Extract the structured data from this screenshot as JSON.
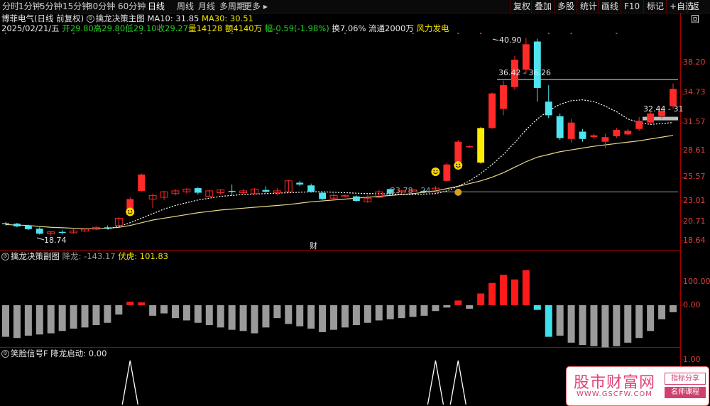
{
  "toolbar": {
    "timeframes": [
      "分时",
      "1分钟",
      "5分钟",
      "15分钟",
      "30分钟",
      "60分钟",
      "日线",
      "周线",
      "月线",
      "多周期",
      "更多"
    ],
    "active_timeframe": "日线",
    "buttons": [
      "复权",
      "叠加",
      "多股",
      "统计",
      "画线",
      "F10",
      "标记",
      "+自选",
      "返回"
    ]
  },
  "main": {
    "stock": "博菲电气(日线 前复权)",
    "indicator": "擒龙决策主图",
    "ma10": "MA10: 31.85",
    "ma30": "MA30: 30.51",
    "date": "2025/02/21/五",
    "open": "开29.80",
    "high": "高29.80",
    "low": "低29.10",
    "close": "收29.27",
    "volume": "量14128",
    "amount": "额4140万",
    "change": "幅-0.59(-1.98%)",
    "turnover": "换7.06%",
    "float_cap": "流通2000万",
    "concept": "风力发电",
    "y_ticks": [
      "38.20",
      "34.73",
      "31.57",
      "28.61",
      "25.57",
      "23.01",
      "20.71",
      "18.64"
    ],
    "annotations": {
      "high_label": "40.90",
      "low_label": "18.74",
      "zone1": "36.42 - 36.26",
      "zone2": "32.44 - 31",
      "zone3": "23.78 - 24",
      "cai": "财"
    }
  },
  "sub1": {
    "title": "擒龙决策副图",
    "label_a": "降龙: -143.17",
    "label_b": "伏虎: 101.83",
    "y_ticks": [
      "100.00",
      "0.00"
    ]
  },
  "sub2": {
    "title": "笑脸信号F",
    "label_a": "降龙启动: 0.00",
    "y_ticks": [
      "1.00"
    ]
  },
  "watermark": {
    "logo": "股市财富网",
    "url": "WWW.GSCFW.COM",
    "tag1": "指标分享",
    "tag2": "名师课程"
  },
  "chart_data": {
    "type": "candlestick",
    "x_count": 60,
    "y_ticks": [
      38.2,
      34.73,
      31.57,
      28.61,
      25.57,
      23.01,
      20.71,
      18.64
    ],
    "candles": [
      [
        20.55,
        20.45,
        20.7,
        20.3
      ],
      [
        20.5,
        20.2,
        20.6,
        20.1
      ],
      [
        20.3,
        19.9,
        20.4,
        19.8
      ],
      [
        19.95,
        19.4,
        20.1,
        19.3
      ],
      [
        19.4,
        19.6,
        19.7,
        19.2
      ],
      [
        19.6,
        19.5,
        19.8,
        19.3
      ],
      [
        19.5,
        19.7,
        19.9,
        19.4
      ],
      [
        19.7,
        19.9,
        20.0,
        19.6
      ],
      [
        19.9,
        20.1,
        20.2,
        19.8
      ],
      [
        20.1,
        20.05,
        20.3,
        19.9
      ],
      [
        20.3,
        21.1,
        21.2,
        20.2
      ],
      [
        21.5,
        23.2,
        23.4,
        21.4
      ],
      [
        24.1,
        25.9,
        26.0,
        24.0
      ],
      [
        23.2,
        23.6,
        23.8,
        22.2
      ],
      [
        23.4,
        24.0,
        24.1,
        23.1
      ],
      [
        23.8,
        24.1,
        24.3,
        23.6
      ],
      [
        24.0,
        24.3,
        24.4,
        23.8
      ],
      [
        24.4,
        23.9,
        24.5,
        23.7
      ],
      [
        23.5,
        24.1,
        24.2,
        23.4
      ],
      [
        23.9,
        24.2,
        24.3,
        23.7
      ],
      [
        24.1,
        24.0,
        24.8,
        23.6
      ],
      [
        23.9,
        24.1,
        24.3,
        23.7
      ],
      [
        23.8,
        24.3,
        24.4,
        23.7
      ],
      [
        24.2,
        24.0,
        24.6,
        23.9
      ],
      [
        23.9,
        24.1,
        24.4,
        23.6
      ],
      [
        24.0,
        25.2,
        25.3,
        23.9
      ],
      [
        25.0,
        24.8,
        25.2,
        24.6
      ],
      [
        24.7,
        24.0,
        24.9,
        23.9
      ],
      [
        23.9,
        23.2,
        24.0,
        23.1
      ],
      [
        23.3,
        23.6,
        23.8,
        23.2
      ],
      [
        23.5,
        23.6,
        23.7,
        23.4
      ],
      [
        23.5,
        23.0,
        23.6,
        22.9
      ],
      [
        22.9,
        23.3,
        23.6,
        22.8
      ],
      [
        23.4,
        24.0,
        24.2,
        23.3
      ],
      [
        24.3,
        23.8,
        24.4,
        23.7
      ],
      [
        24.0,
        24.1,
        24.2,
        23.8
      ],
      [
        24.1,
        24.2,
        24.3,
        23.9
      ],
      [
        24.1,
        24.0,
        24.3,
        23.9
      ],
      [
        24.0,
        24.4,
        24.6,
        23.9
      ],
      [
        25.2,
        27.0,
        27.2,
        25.1
      ],
      [
        27.3,
        29.5,
        29.7,
        27.2
      ],
      [
        28.9,
        29.0,
        29.1,
        28.8
      ],
      [
        27.2,
        31.0,
        31.1,
        27.1
      ],
      [
        31.0,
        34.8,
        34.9,
        30.9
      ],
      [
        33.1,
        35.7,
        36.2,
        32.4
      ],
      [
        35.5,
        38.5,
        38.9,
        35.2
      ],
      [
        37.4,
        40.2,
        40.9,
        37.0
      ],
      [
        40.5,
        35.4,
        40.8,
        33.9
      ],
      [
        33.9,
        32.4,
        35.7,
        32.1
      ],
      [
        32.3,
        29.9,
        32.6,
        29.7
      ],
      [
        29.8,
        31.6,
        32.0,
        29.4
      ],
      [
        30.6,
        29.8,
        30.9,
        29.5
      ],
      [
        30.0,
        30.2,
        30.4,
        29.8
      ],
      [
        29.5,
        30.0,
        30.4,
        28.8
      ],
      [
        30.1,
        30.8,
        31.0,
        29.9
      ],
      [
        30.3,
        30.7,
        30.9,
        30.2
      ],
      [
        30.9,
        31.8,
        32.2,
        30.7
      ],
      [
        31.6,
        32.6,
        32.8,
        31.5
      ],
      [
        32.3,
        32.9,
        33.2,
        32.0
      ],
      [
        33.4,
        35.3,
        35.9,
        33.1
      ]
    ],
    "ma_slow": [
      20.4,
      20.35,
      20.3,
      20.2,
      20.1,
      20.05,
      20.0,
      19.95,
      19.95,
      20.0,
      20.1,
      20.3,
      20.6,
      20.9,
      21.1,
      21.3,
      21.5,
      21.7,
      21.85,
      22.0,
      22.1,
      22.2,
      22.3,
      22.4,
      22.5,
      22.6,
      22.75,
      22.9,
      23.0,
      23.1,
      23.2,
      23.3,
      23.4,
      23.5,
      23.6,
      23.7,
      23.8,
      23.95,
      24.1,
      24.35,
      24.6,
      24.9,
      25.2,
      25.6,
      26.1,
      26.7,
      27.3,
      27.8,
      28.1,
      28.4,
      28.6,
      28.8,
      29.0,
      29.15,
      29.3,
      29.45,
      29.6,
      29.8,
      30.0,
      30.2
    ],
    "ma_fast": [
      null,
      null,
      null,
      null,
      null,
      null,
      null,
      null,
      null,
      19.9,
      20.2,
      20.6,
      21.1,
      21.6,
      22.1,
      22.5,
      22.8,
      23.1,
      23.3,
      23.5,
      23.6,
      23.7,
      23.75,
      23.8,
      23.85,
      23.9,
      23.95,
      24.0,
      24.0,
      23.95,
      23.9,
      23.85,
      23.8,
      23.8,
      23.75,
      23.75,
      23.7,
      23.75,
      23.8,
      24.1,
      24.6,
      25.2,
      26.0,
      27.0,
      28.1,
      29.4,
      30.8,
      32.0,
      32.9,
      33.6,
      34.0,
      34.1,
      33.9,
      33.4,
      32.8,
      32.0,
      31.6,
      31.4,
      31.5,
      31.6
    ],
    "sub1_bars": [
      -135,
      -140,
      -130,
      -125,
      -120,
      -110,
      -100,
      -95,
      -85,
      -75,
      -40,
      15,
      12,
      -45,
      -35,
      -55,
      -65,
      -75,
      -85,
      -95,
      -105,
      -110,
      -120,
      -95,
      -55,
      -80,
      -90,
      -100,
      -115,
      -105,
      -95,
      -85,
      -75,
      -65,
      -60,
      -55,
      -50,
      -45,
      -25,
      -10,
      20,
      -15,
      50,
      95,
      130,
      110,
      150,
      -20,
      -135,
      -130,
      -160,
      -170,
      -175,
      -180,
      -175,
      -160,
      -140,
      -110,
      -60,
      -30
    ],
    "sub2_spikes": [
      11,
      38,
      40
    ]
  }
}
